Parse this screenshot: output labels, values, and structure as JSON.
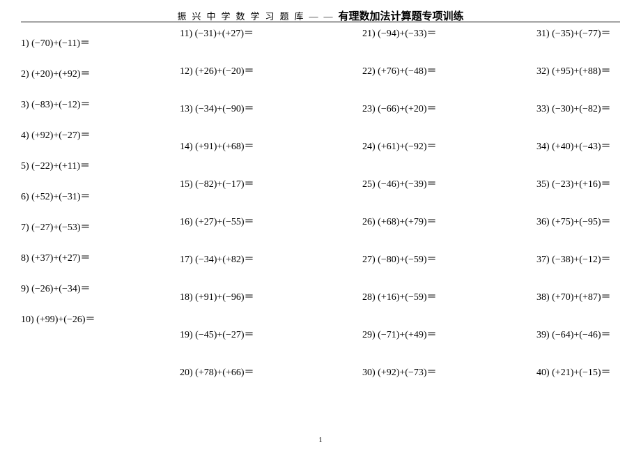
{
  "header": {
    "prefix": "振兴中学数学习题库——",
    "title": "有理数加法计算题专项训练"
  },
  "page_number": "1",
  "col1": [
    "1) (−70)+(−11)＝",
    "2) (+20)+(+92)＝",
    "3) (−83)+(−12)＝",
    "4) (+92)+(−27)＝",
    "5) (−22)+(+11)＝",
    "6) (+52)+(−31)＝",
    "7) (−27)+(−53)＝",
    "8) (+37)+(+27)＝",
    "9) (−26)+(−34)＝",
    "10) (+99)+(−26)＝"
  ],
  "col2": [
    "11) (−31)+(+27)＝",
    "12) (+26)+(−20)＝",
    "13) (−34)+(−90)＝",
    "14) (+91)+(+68)＝",
    "15) (−82)+(−17)＝",
    "16) (+27)+(−55)＝",
    "17) (−34)+(+82)＝",
    "18) (+91)+(−96)＝",
    "19) (−45)+(−27)＝",
    "20) (+78)+(+66)＝"
  ],
  "col3": [
    "21) (−94)+(−33)＝",
    "22) (+76)+(−48)＝",
    "23) (−66)+(+20)＝",
    "24) (+61)+(−92)＝",
    "25) (−46)+(−39)＝",
    "26) (+68)+(+79)＝",
    "27) (−80)+(−59)＝",
    "28) (+16)+(−59)＝",
    "29) (−71)+(+49)＝",
    "30) (+92)+(−73)＝"
  ],
  "col4": [
    "31) (−35)+(−77)＝",
    "32) (+95)+(+88)＝",
    "33) (−30)+(−82)＝",
    "34) (+40)+(−43)＝",
    "35) (−23)+(+16)＝",
    "36) (+75)+(−95)＝",
    "37) (−38)+(−12)＝",
    "38) (+70)+(+87)＝",
    "39) (−64)+(−46)＝",
    "40) (+21)+(−15)＝"
  ]
}
